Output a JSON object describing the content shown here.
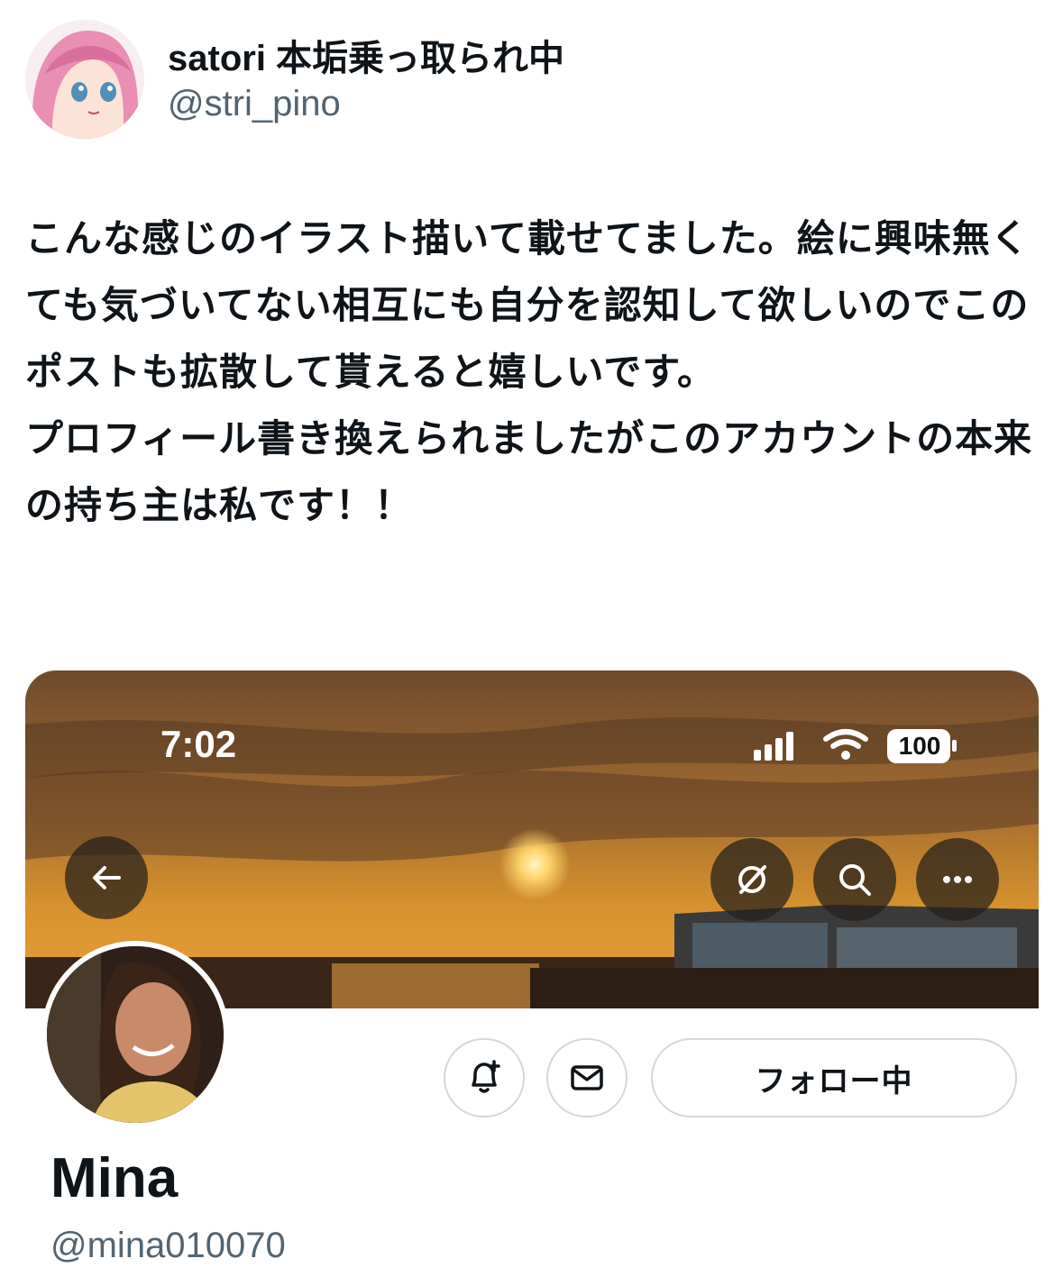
{
  "post": {
    "author_name": "satori 本垢乗っ取られ中",
    "author_handle": "@stri_pino",
    "text_paragraphs": [
      "こんな感じのイラスト描いて載せてました。絵に興味無くても気づいてない相互にも自分を認知して欲しいのでこのポストも拡散して貰えると嬉しいです。",
      "プロフィール書き換えられましたがこのアカウントの本来の持ち主は私です！！"
    ]
  },
  "embedded_profile": {
    "status_time": "7:02",
    "battery": "100",
    "icons": {
      "back": "arrow-left-icon",
      "grok": "grok-icon",
      "search": "search-icon",
      "more": "more-horizontal-icon",
      "notify": "bell-plus-icon",
      "message": "envelope-icon"
    },
    "follow_button_label": "フォロー中",
    "name": "Mina",
    "handle": "@mina010070"
  },
  "colors": {
    "text": "#0f1419",
    "secondary_text": "#536471",
    "border": "#cfd9de",
    "banner_sky": "#c57a2a"
  }
}
